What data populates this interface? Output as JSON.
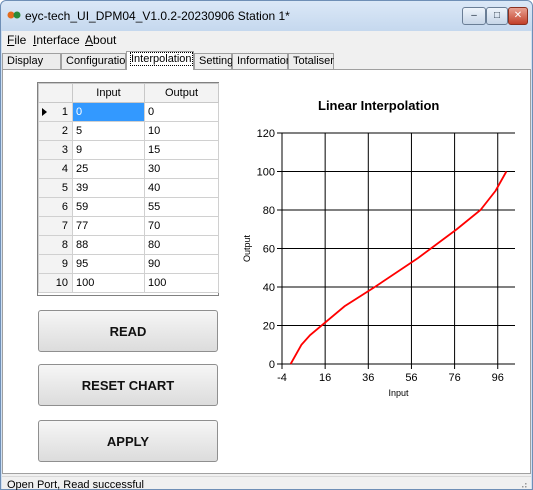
{
  "window": {
    "title": "eyc-tech_UI_DPM04_V1.0.2-20230906  Station 1*",
    "controls": {
      "minimize": "–",
      "maximize": "□",
      "close": "✕"
    }
  },
  "menu": [
    {
      "label": "File",
      "underline": "F",
      "rest": "ile"
    },
    {
      "label": "Interface",
      "underline": "I",
      "rest": "nterface"
    },
    {
      "label": "About",
      "underline": "A",
      "rest": "bout"
    }
  ],
  "tabs": [
    "Display",
    "Configuration",
    "Interpolation",
    "Setting",
    "Information",
    "Totaliser"
  ],
  "active_tab": "Interpolation",
  "table": {
    "headers": [
      "Input",
      "Output"
    ],
    "rows": [
      {
        "n": "1",
        "input": "0",
        "output": "0"
      },
      {
        "n": "2",
        "input": "5",
        "output": "10"
      },
      {
        "n": "3",
        "input": "9",
        "output": "15"
      },
      {
        "n": "4",
        "input": "25",
        "output": "30"
      },
      {
        "n": "5",
        "input": "39",
        "output": "40"
      },
      {
        "n": "6",
        "input": "59",
        "output": "55"
      },
      {
        "n": "7",
        "input": "77",
        "output": "70"
      },
      {
        "n": "8",
        "input": "88",
        "output": "80"
      },
      {
        "n": "9",
        "input": "95",
        "output": "90"
      },
      {
        "n": "10",
        "input": "100",
        "output": "100"
      }
    ]
  },
  "buttons": {
    "read": "READ",
    "reset": "RESET CHART",
    "apply": "APPLY"
  },
  "chart_data": {
    "type": "line",
    "title": "Linear Interpolation",
    "xlabel": "Input",
    "ylabel": "Output",
    "xlim": [
      -4,
      104
    ],
    "ylim": [
      0,
      120
    ],
    "xticks": [
      -4,
      16,
      36,
      56,
      76,
      96
    ],
    "yticks": [
      0,
      20,
      40,
      60,
      80,
      100,
      120
    ],
    "grid": true,
    "series": [
      {
        "color": "#ff0000",
        "x": [
          0,
          5,
          9,
          25,
          39,
          59,
          77,
          88,
          95,
          100
        ],
        "y": [
          0,
          10,
          15,
          30,
          40,
          55,
          70,
          80,
          90,
          100
        ]
      }
    ]
  },
  "status": {
    "text": "Open Port,   Read successful"
  }
}
